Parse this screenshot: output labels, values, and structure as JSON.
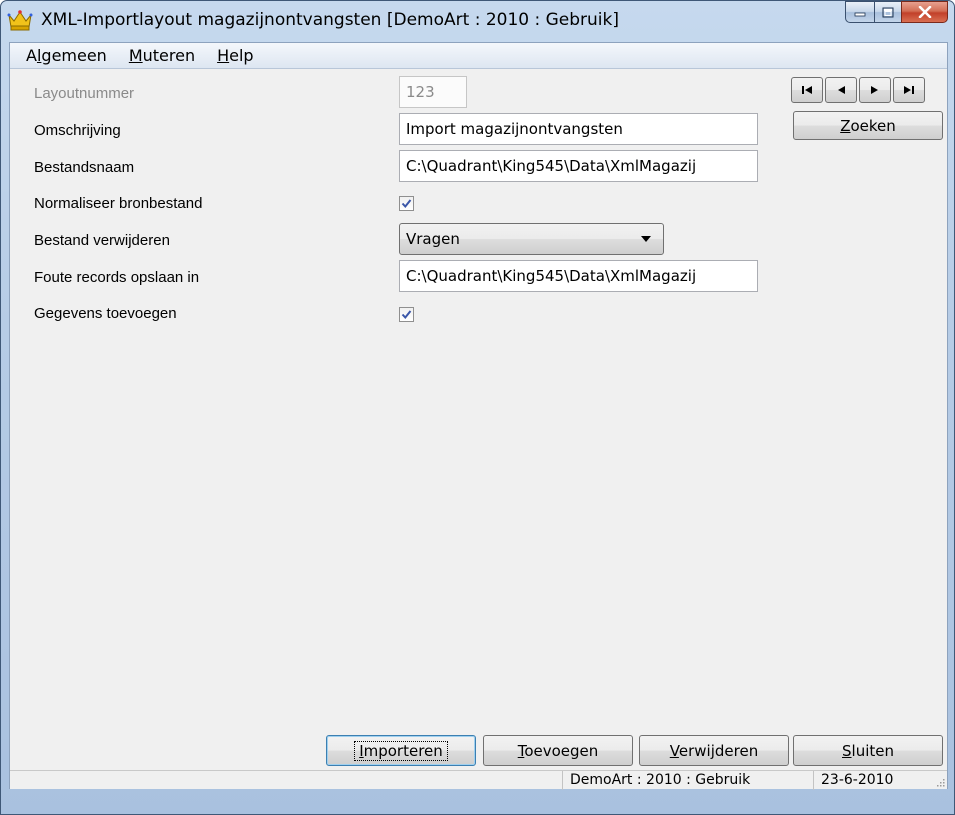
{
  "window": {
    "title": "XML-Importlayout magazijnontvangsten  [DemoArt : 2010 : Gebruik]",
    "icon": "crown-icon"
  },
  "menu": {
    "items": [
      {
        "pre": "A",
        "ul": "l",
        "post": "gemeen"
      },
      {
        "pre": "",
        "ul": "M",
        "post": "uteren"
      },
      {
        "pre": "",
        "ul": "H",
        "post": "elp"
      }
    ]
  },
  "form": {
    "layoutnummer_label": "Layoutnummer",
    "layoutnummer_value": "123",
    "omschrijving_label": "Omschrijving",
    "omschrijving_value": "Import magazijnontvangsten",
    "bestandsnaam_label": "Bestandsnaam",
    "bestandsnaam_value": "C:\\Quadrant\\King545\\Data\\XmlMagazij",
    "normaliseer_label": "Normaliseer bronbestand",
    "normaliseer_checked": true,
    "verwijderen_label": "Bestand verwijderen",
    "verwijderen_value": "Vragen",
    "foute_label": "Foute records opslaan in",
    "foute_value": "C:\\Quadrant\\King545\\Data\\XmlMagazij",
    "toevoegen_label": "Gegevens toevoegen",
    "toevoegen_checked": true
  },
  "nav": {
    "first": "first-record-icon",
    "prev": "previous-record-icon",
    "next": "next-record-icon",
    "last": "last-record-icon"
  },
  "buttons": {
    "zoeken": {
      "ul": "Z",
      "rest": "oeken"
    },
    "importeren": {
      "ul": "I",
      "rest": "mporteren"
    },
    "toevoegen": {
      "ul": "T",
      "rest": "oevoegen"
    },
    "verwijderen": {
      "ul": "V",
      "rest": "erwijderen"
    },
    "sluiten": {
      "ul": "S",
      "rest": "luiten"
    }
  },
  "status": {
    "context": "DemoArt : 2010 : Gebruik",
    "date": "23-6-2010"
  },
  "colors": {
    "frame": "#b6cce6",
    "client": "#f0f0f0",
    "close_button": "#c2402a"
  }
}
